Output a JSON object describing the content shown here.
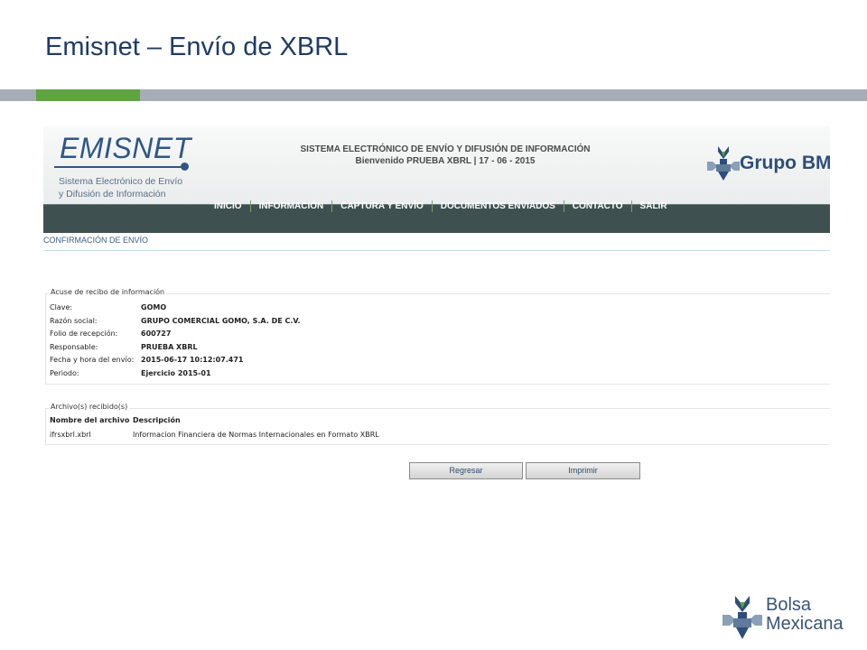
{
  "slide": {
    "title": "Emisnet – Envío de XBRL"
  },
  "header": {
    "logo_text": "EMISNET",
    "logo_subtitle_line1": "Sistema Electrónico de Envío",
    "logo_subtitle_line2": "y Difusión de Información",
    "system_title": "SISTEMA ELECTRÓNICO DE ENVÍO Y DIFUSIÓN DE INFORMACIÓN",
    "welcome": "Bienvenido PRUEBA XBRL | 17 - 06 - 2015",
    "brand_logo": "Grupo BMV"
  },
  "nav": {
    "items": [
      {
        "label": "INICIO"
      },
      {
        "label": "INFORMACIÓN"
      },
      {
        "label": "CAPTURA Y ENVÍO"
      },
      {
        "label": "DOCUMENTOS ENVIADOS"
      },
      {
        "label": "CONTACTO"
      },
      {
        "label": "SALIR"
      }
    ]
  },
  "breadcrumb": "CONFIRMACIÓN DE ENVÍO",
  "receipt": {
    "legend": "Acuse de recibo de información",
    "rows": [
      {
        "label": "Clave:",
        "value": "GOMO"
      },
      {
        "label": "Razón social:",
        "value": "GRUPO COMERCIAL GOMO, S.A. DE C.V."
      },
      {
        "label": "Folio de recepción:",
        "value": "600727"
      },
      {
        "label": "Responsable:",
        "value": "PRUEBA XBRL"
      },
      {
        "label": "Fecha y hora del envío:",
        "value": "2015-06-17 10:12:07.471"
      },
      {
        "label": "Periodo:",
        "value": "Ejercicio 2015-01"
      }
    ]
  },
  "files": {
    "legend": "Archivo(s) recibido(s)",
    "headers": [
      "Nombre del archivo",
      "Descripción"
    ],
    "rows": [
      [
        "ifrsxbrl.xbrl",
        "Informacion Financiera de Normas Internacionales en Formato XBRL"
      ]
    ]
  },
  "buttons": {
    "back": "Regresar",
    "print": "Imprimir"
  },
  "footer_logo": {
    "line1": "Bolsa",
    "line2": "Mexicana"
  },
  "colors": {
    "title": "#1f3b66",
    "accent_green": "#5fa441",
    "rule_gray": "#a6adb7",
    "navbar": "#3f5051",
    "brand_blue": "#2d4e7b"
  }
}
